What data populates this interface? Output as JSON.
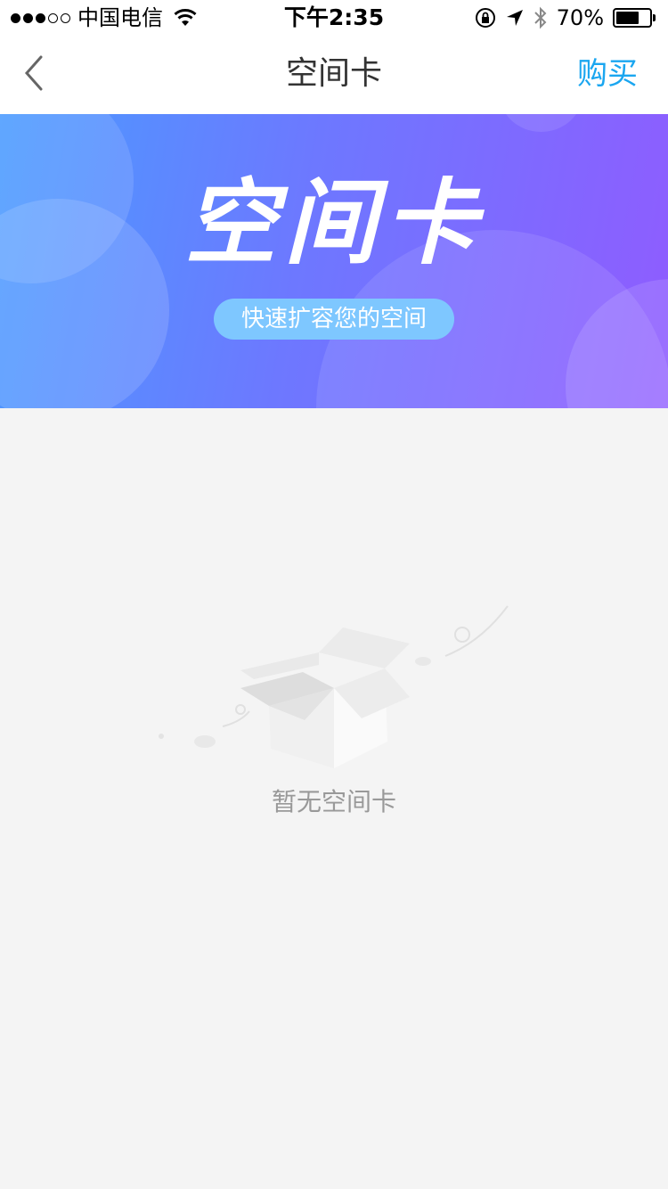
{
  "status_bar": {
    "carrier": "中国电信",
    "time": "下午2:35",
    "battery_percent": "70%",
    "battery_level": 0.7,
    "signal_bars_filled": 3,
    "signal_bars_total": 5,
    "icons": [
      "wifi-icon",
      "rotation-lock-icon",
      "location-arrow-icon",
      "bluetooth-icon",
      "battery-icon"
    ]
  },
  "nav": {
    "title": "空间卡",
    "buy_label": "购买",
    "back_icon": "chevron-left-icon"
  },
  "banner": {
    "title": "空间卡",
    "subtitle": "快速扩容您的空间"
  },
  "empty_state": {
    "icon": "empty-box-icon",
    "text": "暂无空间卡"
  },
  "colors": {
    "accent": "#1aa6f0",
    "banner_start": "#4a9bff",
    "banner_end": "#8f5cff",
    "page_bg": "#f4f4f4",
    "empty_text": "#999999"
  }
}
